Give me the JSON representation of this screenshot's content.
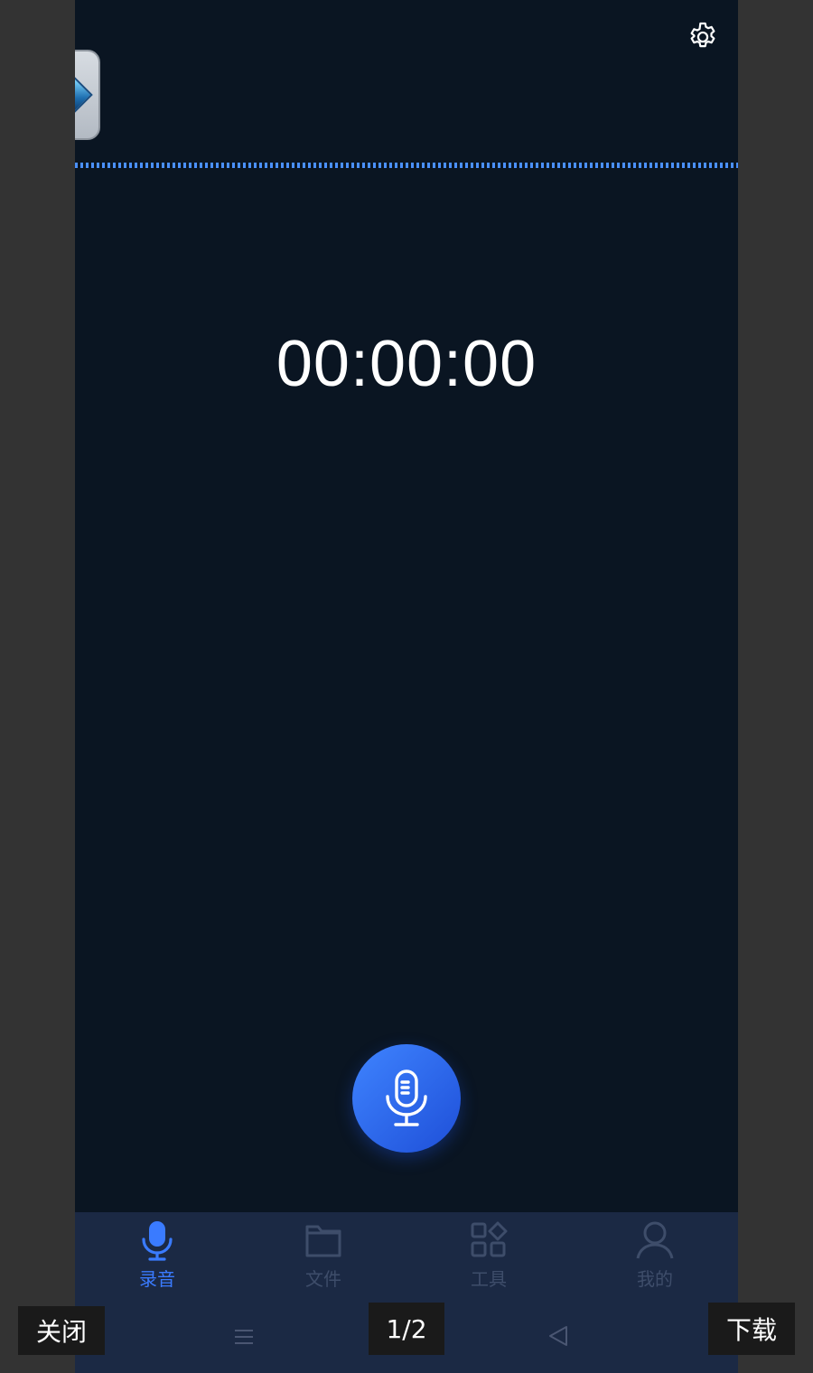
{
  "app": {
    "timer": "00:00:00",
    "accent_color": "#3a7bff",
    "background_color": "#0a1522",
    "icons": {
      "settings": "gear-icon",
      "floating_app": "app-shortcut-icon",
      "record": "microphone-icon"
    }
  },
  "tabs": [
    {
      "label": "录音",
      "icon": "microphone-icon",
      "active": true
    },
    {
      "label": "文件",
      "icon": "folder-icon",
      "active": false
    },
    {
      "label": "工具",
      "icon": "tools-grid-icon",
      "active": false
    },
    {
      "label": "我的",
      "icon": "user-icon",
      "active": false
    }
  ],
  "system_nav": {
    "icons": [
      "menu-icon",
      "home-icon",
      "back-icon"
    ]
  },
  "viewer": {
    "close_label": "关闭",
    "page_indicator": "1/2",
    "download_label": "下载"
  }
}
